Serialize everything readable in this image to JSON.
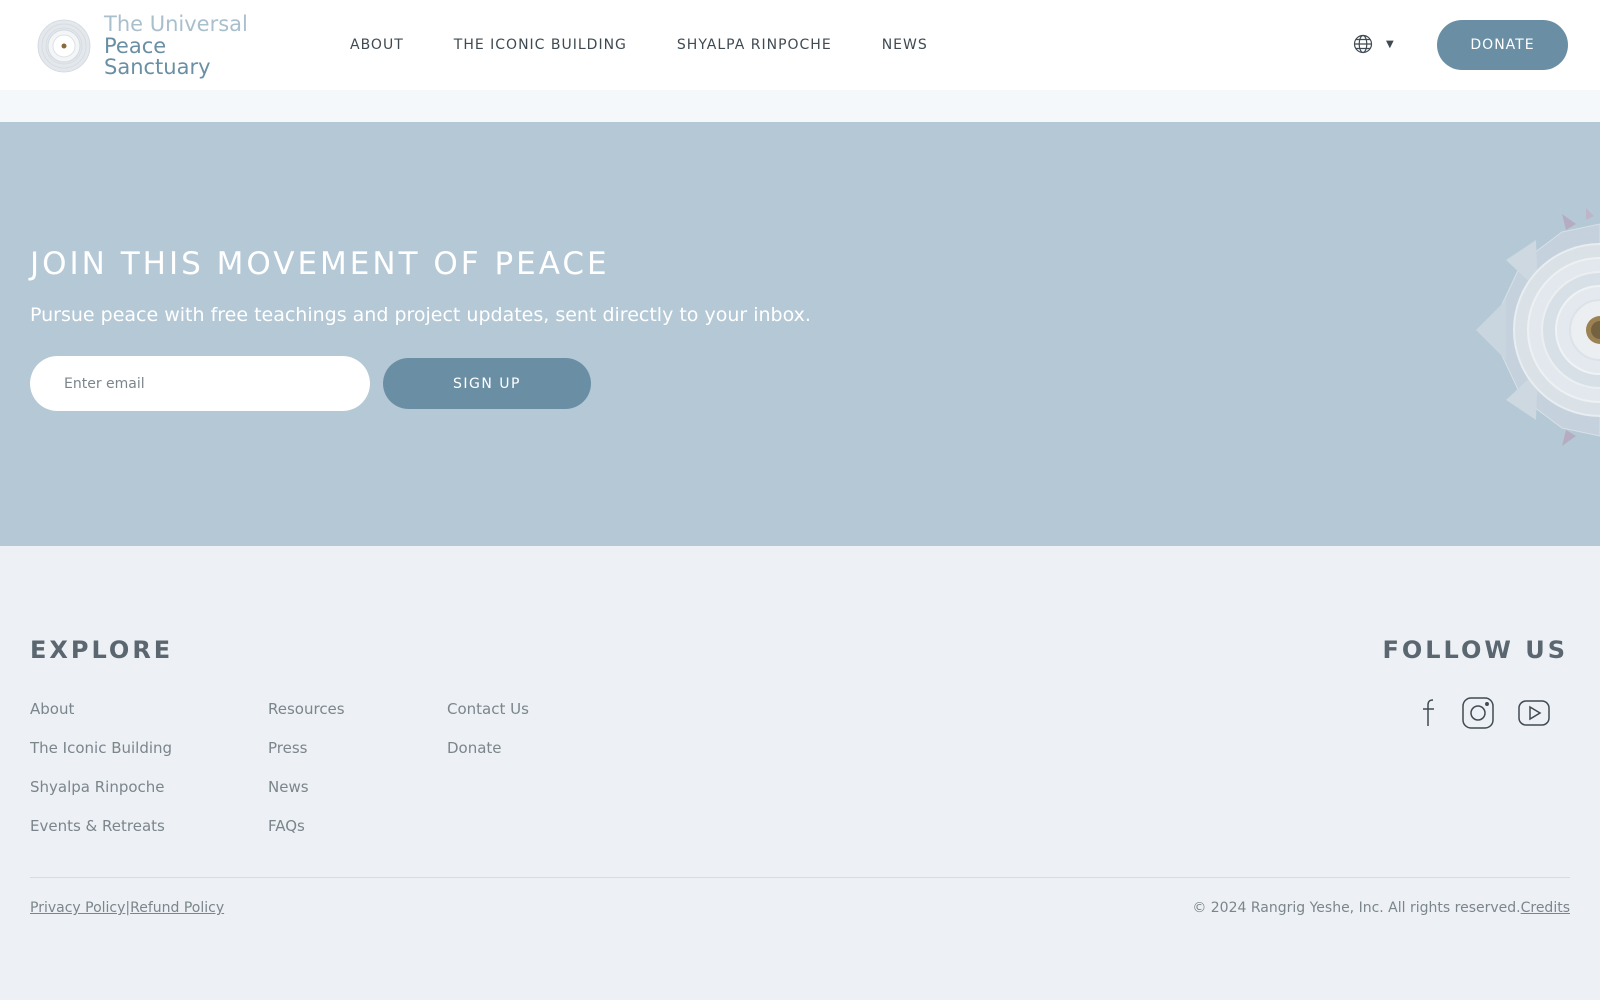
{
  "header": {
    "logo": {
      "line1": "The Universal",
      "line2": "Peace Sanctuary"
    },
    "nav": [
      "ABOUT",
      "THE ICONIC BUILDING",
      "SHYALPA RINPOCHE",
      "NEWS"
    ],
    "language_icon": "globe-icon",
    "language_caret": "▼",
    "donate_label": "DONATE"
  },
  "newsletter": {
    "title": "JOIN THIS MOVEMENT OF PEACE",
    "subtitle": "Pursue peace with free teachings and project updates, sent directly to your inbox.",
    "email_placeholder": "Enter email",
    "signup_label": "SIGN UP"
  },
  "footer": {
    "explore_heading": "EXPLORE",
    "follow_heading": "FOLLOW US",
    "columns": [
      [
        "About",
        "The Iconic Building",
        "Shyalpa Rinpoche",
        "Events & Retreats"
      ],
      [
        "Resources",
        "Press",
        "News",
        "FAQs"
      ],
      [
        "Contact Us",
        "Donate"
      ]
    ],
    "social_icons": [
      "facebook-icon",
      "instagram-icon",
      "youtube-icon"
    ],
    "privacy_label": "Privacy Policy",
    "separator": "|",
    "refund_label": "Refund Policy",
    "copyright": "© 2024 Rangrig Yeshe, Inc. All rights reserved.",
    "credits_label": "Credits"
  },
  "colors": {
    "accent": "#6a8fa4",
    "band_background": "#b4c8d6",
    "footer_background": "#edf1f5",
    "header_background": "#ffffff"
  }
}
